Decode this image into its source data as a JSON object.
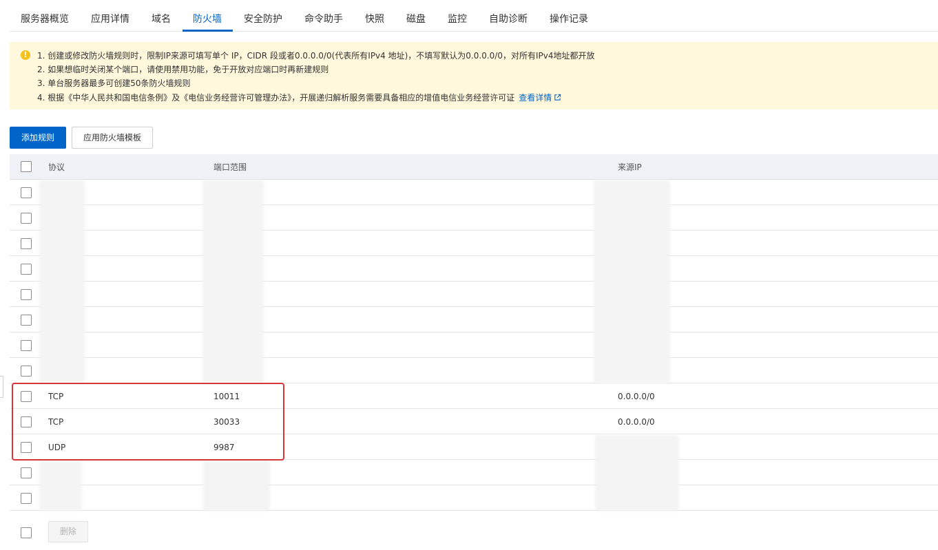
{
  "tabs": [
    {
      "label": "服务器概览"
    },
    {
      "label": "应用详情"
    },
    {
      "label": "域名"
    },
    {
      "label": "防火墙",
      "active": true
    },
    {
      "label": "安全防护"
    },
    {
      "label": "命令助手"
    },
    {
      "label": "快照"
    },
    {
      "label": "磁盘"
    },
    {
      "label": "监控"
    },
    {
      "label": "自助诊断"
    },
    {
      "label": "操作记录"
    }
  ],
  "notice": {
    "icon": "warning-icon",
    "lines": [
      "1. 创建或修改防火墙规则时，限制IP来源可填写单个 IP，CIDR 段或者0.0.0.0/0(代表所有IPv4 地址)，不填写默认为0.0.0.0/0，对所有IPv4地址都开放",
      "2. 如果想临时关闭某个端口，请使用禁用功能，免于开放对应端口时再新建规则",
      "3. 单台服务器最多可创建50条防火墙规则",
      "4. 根据《中华人民共和国电信条例》及《电信业务经营许可管理办法》，开展递归解析服务需要具备相应的增值电信业务经营许可证"
    ],
    "link_label": "查看详情"
  },
  "toolbar": {
    "add_rule_label": "添加规则",
    "apply_template_label": "应用防火墙模板"
  },
  "table": {
    "headers": {
      "protocol": "协议",
      "port_range": "端口范围",
      "source_ip": "来源IP"
    },
    "rows": [
      {
        "protocol": "",
        "port": "",
        "source": ""
      },
      {
        "protocol": "",
        "port": "",
        "source": ""
      },
      {
        "protocol": "",
        "port": "",
        "source": ""
      },
      {
        "protocol": "",
        "port": "",
        "source": ""
      },
      {
        "protocol": "",
        "port": "",
        "source": ""
      },
      {
        "protocol": "",
        "port": "",
        "source": ""
      },
      {
        "protocol": "",
        "port": "",
        "source": ""
      },
      {
        "protocol": "",
        "port": "",
        "source": ""
      },
      {
        "protocol": "TCP",
        "port": "10011",
        "source": "0.0.0.0/0"
      },
      {
        "protocol": "TCP",
        "port": "30033",
        "source": "0.0.0.0/0"
      },
      {
        "protocol": "UDP",
        "port": "9987",
        "source": ""
      },
      {
        "protocol": "",
        "port": "",
        "source": ""
      },
      {
        "protocol": "",
        "port": "",
        "source": ""
      }
    ]
  },
  "footer": {
    "delete_label": "删除"
  },
  "colors": {
    "accent": "#0064c8",
    "notice_bg": "#fff8dc",
    "highlight": "#d9343a"
  }
}
